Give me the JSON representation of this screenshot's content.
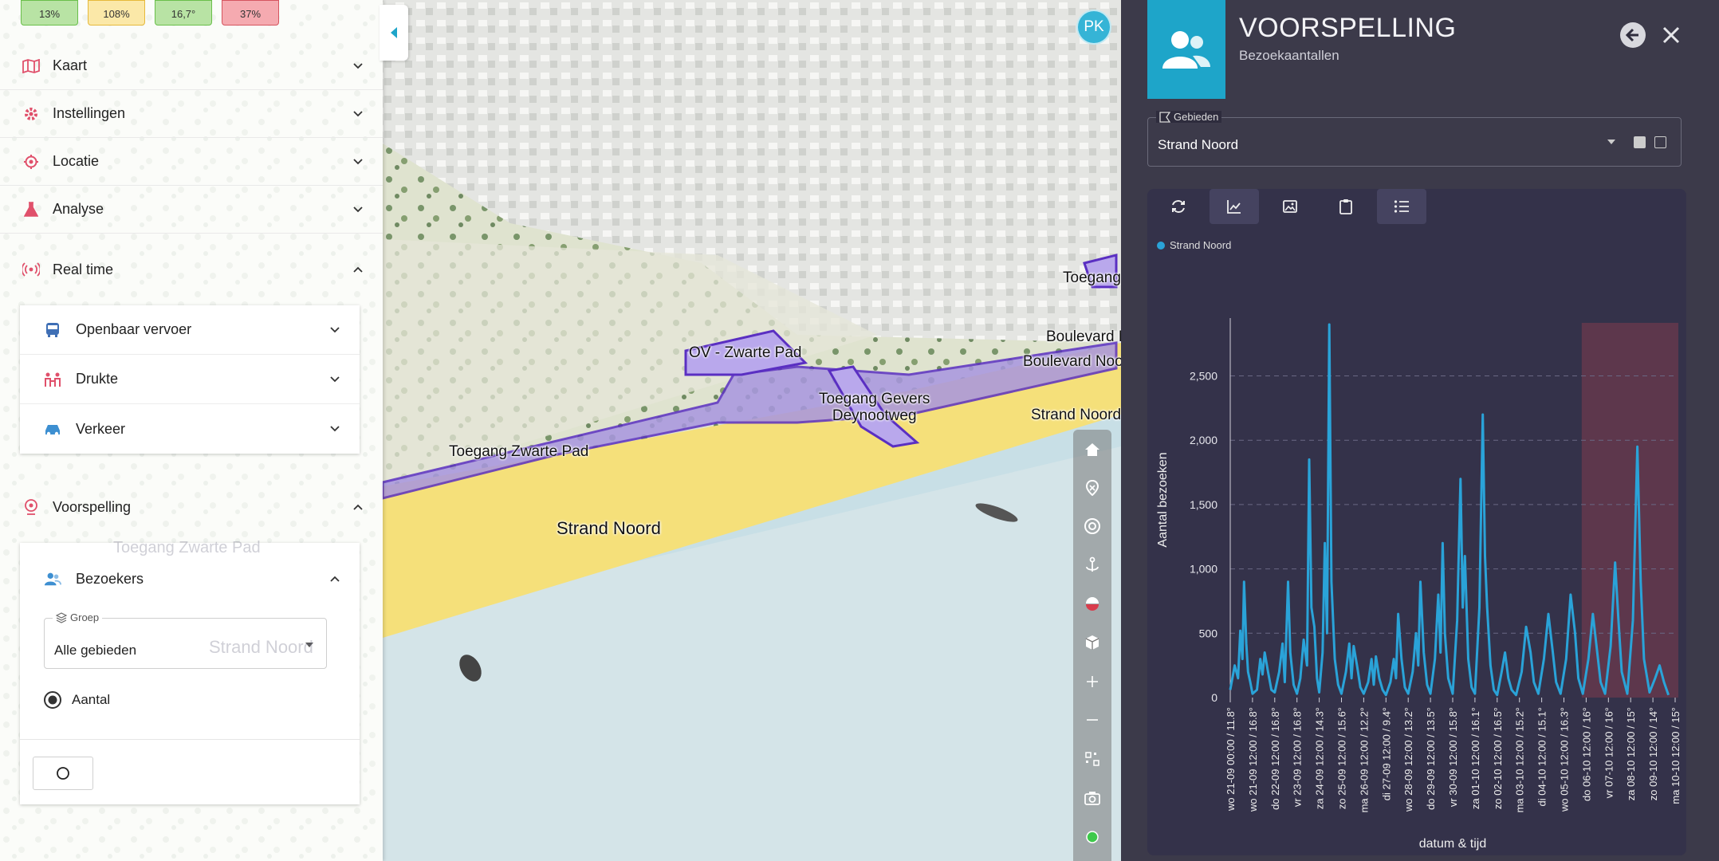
{
  "kpis": [
    {
      "value": "13%",
      "status": "green"
    },
    {
      "value": "108%",
      "status": "yellow"
    },
    {
      "value": "16,7°",
      "status": "green"
    },
    {
      "value": "37%",
      "status": "red"
    }
  ],
  "menu": {
    "kaart": "Kaart",
    "instellingen": "Instellingen",
    "locatie": "Locatie",
    "analyse": "Analyse",
    "realtime": "Real time",
    "voorspelling": "Voorspelling"
  },
  "realtime_items": {
    "ov": "Openbaar vervoer",
    "drukte": "Drukte",
    "verkeer": "Verkeer"
  },
  "forecast": {
    "bezoekers": "Bezoekers",
    "group_legend": "Groep",
    "group_value": "Alle gebieden",
    "radio_label": "Aantal"
  },
  "user": {
    "initials": "PK"
  },
  "map_labels": {
    "ov_zwarte_pad": "OV - Zwarte Pad",
    "toegang_kurhaus": "Toegang Kurhaus",
    "boulevard_midden": "Boulevard Midden",
    "boulevard_noord": "Boulevard Noord",
    "toegang_gevers_1": "Toegang Gevers",
    "toegang_gevers_2": "Deynootweg",
    "strand_noord_r": "Strand Noord",
    "toegang_zwarte_pad": "Toegang Zwarte Pad",
    "strand_noord": "Strand Noord",
    "ghost_toegang": "Toegang Zwarte Pad",
    "ghost_strand": "Strand Noord"
  },
  "panel": {
    "title": "VOORSPELLING",
    "subtitle": "Bezoekaantallen",
    "area_legend": "Gebieden",
    "area_value": "Strand Noord"
  },
  "colors": {
    "accent": "#1ea5c9",
    "line": "#2aa3d8",
    "forecast_band": "#6b3a4e"
  },
  "chart_data": {
    "type": "line",
    "ylabel": "Aantal bezoeken",
    "xlabel": "datum & tijd",
    "ylim": [
      0,
      2900
    ],
    "yticks": [
      0,
      500,
      1000,
      1500,
      2000,
      2500
    ],
    "ytick_labels": [
      "0",
      "500",
      "1,000",
      "1,500",
      "2,000",
      "2,500"
    ],
    "grid": true,
    "legend_position": "top-left",
    "series": [
      {
        "name": "Strand Noord"
      }
    ],
    "x_tick_labels": [
      "wo 21-09 00:00 / 11.8°",
      "wo 21-09 12:00 / 16.8°",
      "do 22-09 12:00 / 16.8°",
      "vr 23-09 12:00 / 16.8°",
      "za 24-09 12:00 / 14.3°",
      "zo 25-09 12:00 / 15.6°",
      "ma 26-09 12:00 / 12.2°",
      "di 27-09 12:00 / 9.4°",
      "wo 28-09 12:00 / 13.2°",
      "do 29-09 12:00 / 13.5°",
      "vr 30-09 12:00 / 15.8°",
      "za 01-10 12:00 / 16.1°",
      "zo 02-10 12:00 / 16.5°",
      "ma 03-10 12:00 / 15.2°",
      "di 04-10 12:00 / 15.1°",
      "wo 05-10 12:00 / 16.3°",
      "do 06-10 12:00 / 16°",
      "vr 07-10 12:00 / 16°",
      "za 08-10 12:00 / 15°",
      "zo 09-10 12:00 / 14°",
      "ma 10-10 12:00 / 15°"
    ],
    "forecast_start_index": 15.8,
    "points": [
      [
        0,
        60
      ],
      [
        0.2,
        250
      ],
      [
        0.35,
        150
      ],
      [
        0.45,
        520
      ],
      [
        0.55,
        300
      ],
      [
        0.62,
        900
      ],
      [
        0.72,
        420
      ],
      [
        0.8,
        200
      ],
      [
        0.9,
        120
      ],
      [
        1.0,
        30
      ],
      [
        1.2,
        60
      ],
      [
        1.35,
        300
      ],
      [
        1.45,
        180
      ],
      [
        1.55,
        350
      ],
      [
        1.7,
        200
      ],
      [
        1.85,
        60
      ],
      [
        2.0,
        40
      ],
      [
        2.2,
        200
      ],
      [
        2.35,
        420
      ],
      [
        2.45,
        120
      ],
      [
        2.6,
        900
      ],
      [
        2.7,
        350
      ],
      [
        2.85,
        100
      ],
      [
        3.0,
        30
      ],
      [
        3.15,
        150
      ],
      [
        3.3,
        450
      ],
      [
        3.45,
        250
      ],
      [
        3.55,
        1850
      ],
      [
        3.65,
        700
      ],
      [
        3.78,
        550
      ],
      [
        3.9,
        150
      ],
      [
        4.0,
        40
      ],
      [
        4.15,
        350
      ],
      [
        4.25,
        1200
      ],
      [
        4.35,
        500
      ],
      [
        4.45,
        2900
      ],
      [
        4.55,
        900
      ],
      [
        4.7,
        300
      ],
      [
        4.85,
        100
      ],
      [
        5.0,
        30
      ],
      [
        5.2,
        200
      ],
      [
        5.35,
        420
      ],
      [
        5.45,
        150
      ],
      [
        5.55,
        400
      ],
      [
        5.7,
        250
      ],
      [
        5.85,
        80
      ],
      [
        6.0,
        30
      ],
      [
        6.2,
        120
      ],
      [
        6.35,
        300
      ],
      [
        6.45,
        100
      ],
      [
        6.55,
        320
      ],
      [
        6.7,
        150
      ],
      [
        6.85,
        60
      ],
      [
        7.0,
        20
      ],
      [
        7.2,
        120
      ],
      [
        7.35,
        300
      ],
      [
        7.45,
        150
      ],
      [
        7.55,
        650
      ],
      [
        7.7,
        300
      ],
      [
        7.85,
        80
      ],
      [
        8.0,
        30
      ],
      [
        8.2,
        200
      ],
      [
        8.35,
        500
      ],
      [
        8.45,
        250
      ],
      [
        8.55,
        900
      ],
      [
        8.7,
        350
      ],
      [
        8.85,
        100
      ],
      [
        9.0,
        30
      ],
      [
        9.2,
        300
      ],
      [
        9.35,
        800
      ],
      [
        9.45,
        350
      ],
      [
        9.55,
        1200
      ],
      [
        9.65,
        500
      ],
      [
        9.8,
        150
      ],
      [
        10.0,
        30
      ],
      [
        10.2,
        600
      ],
      [
        10.35,
        1700
      ],
      [
        10.45,
        700
      ],
      [
        10.55,
        1100
      ],
      [
        10.7,
        300
      ],
      [
        10.85,
        80
      ],
      [
        11.0,
        30
      ],
      [
        11.2,
        700
      ],
      [
        11.35,
        2200
      ],
      [
        11.45,
        1100
      ],
      [
        11.55,
        700
      ],
      [
        11.7,
        250
      ],
      [
        11.85,
        60
      ],
      [
        12.0,
        20
      ],
      [
        12.2,
        200
      ],
      [
        12.35,
        350
      ],
      [
        12.5,
        150
      ],
      [
        12.65,
        60
      ],
      [
        12.85,
        20
      ],
      [
        13.1,
        200
      ],
      [
        13.3,
        550
      ],
      [
        13.5,
        350
      ],
      [
        13.65,
        120
      ],
      [
        13.85,
        30
      ],
      [
        14.1,
        300
      ],
      [
        14.3,
        650
      ],
      [
        14.5,
        350
      ],
      [
        14.65,
        120
      ],
      [
        14.85,
        30
      ],
      [
        15.1,
        300
      ],
      [
        15.3,
        800
      ],
      [
        15.5,
        500
      ],
      [
        15.65,
        150
      ],
      [
        15.85,
        30
      ],
      [
        16.1,
        300
      ],
      [
        16.3,
        650
      ],
      [
        16.5,
        350
      ],
      [
        16.65,
        120
      ],
      [
        16.85,
        30
      ],
      [
        17.1,
        400
      ],
      [
        17.3,
        1050
      ],
      [
        17.45,
        600
      ],
      [
        17.6,
        200
      ],
      [
        17.85,
        30
      ],
      [
        18.1,
        600
      ],
      [
        18.3,
        1950
      ],
      [
        18.45,
        900
      ],
      [
        18.6,
        300
      ],
      [
        18.85,
        40
      ],
      [
        19.1,
        150
      ],
      [
        19.3,
        250
      ],
      [
        19.5,
        120
      ],
      [
        19.7,
        20
      ]
    ]
  },
  "map_controls": [
    "home-icon",
    "location-pin-icon",
    "target-icon",
    "anchor-icon",
    "weather-icon",
    "cube-icon",
    "plus-icon",
    "minus-icon",
    "qr-icon",
    "camera-icon",
    "status-dot-icon"
  ]
}
